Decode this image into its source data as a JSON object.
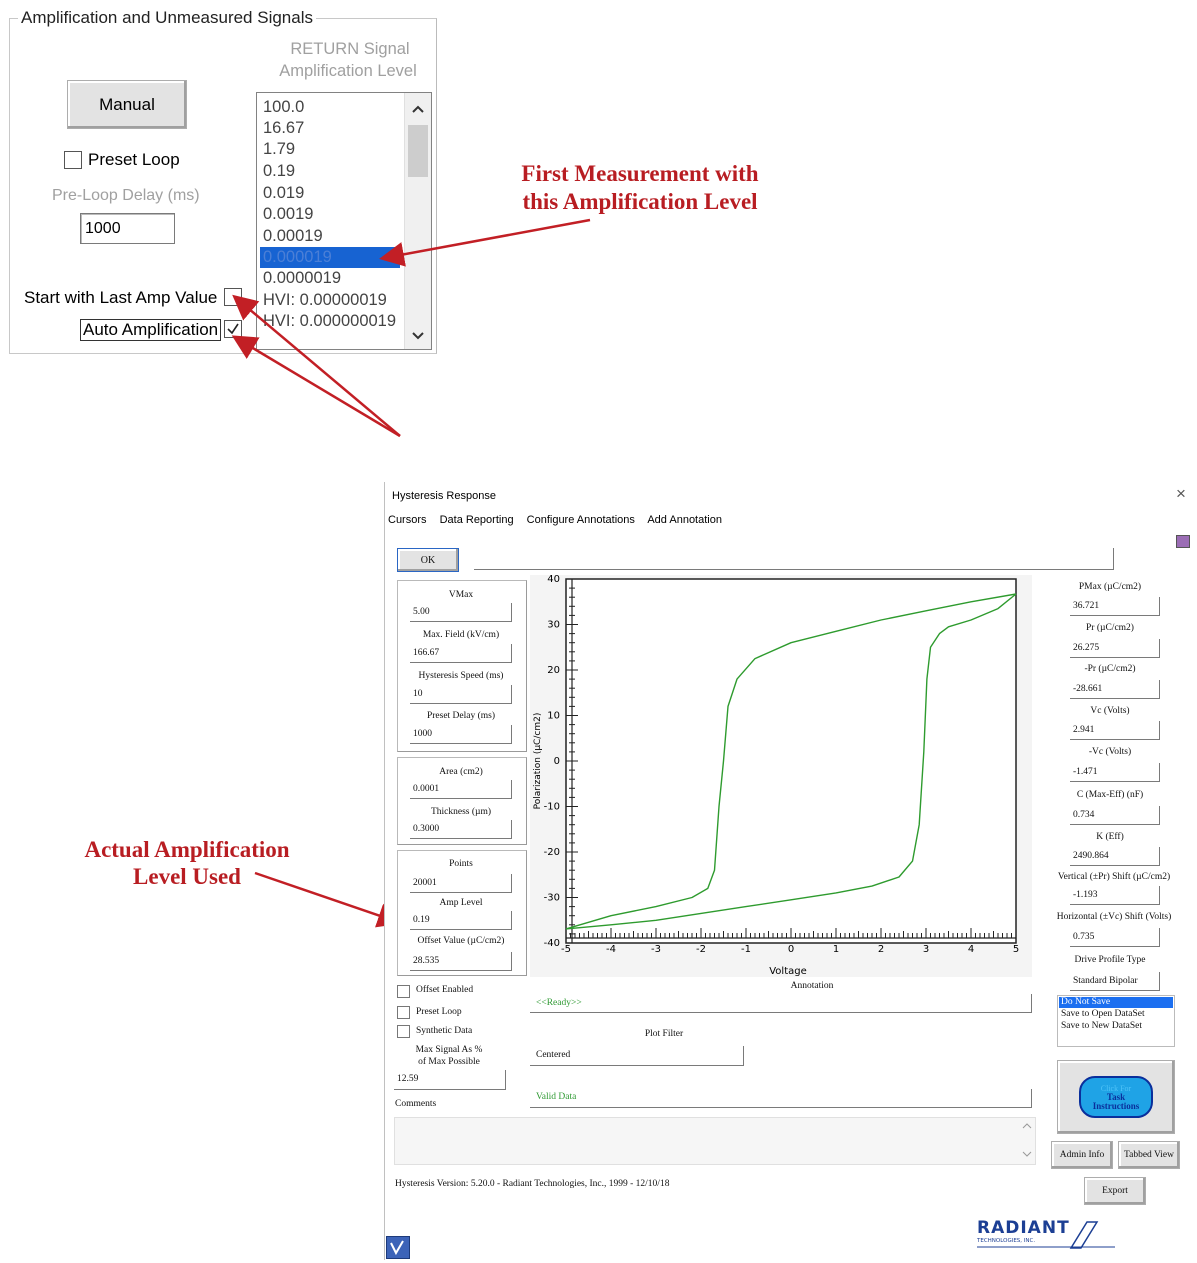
{
  "amp_panel": {
    "title": "Amplification and Unmeasured Signals",
    "manual_button": "Manual",
    "preset_loop_label": "Preset Loop",
    "preset_loop_checked": false,
    "preloop_delay_label": "Pre-Loop Delay (ms)",
    "preloop_delay_value": "1000",
    "return_signal_label_1": "RETURN Signal",
    "return_signal_label_2": "Amplification Level",
    "amp_levels": [
      "100.0",
      "16.67",
      "1.79",
      "0.19",
      "0.019",
      "0.0019",
      "0.00019",
      "0.000019",
      "0.0000019",
      "HVI: 0.00000019",
      "HVI: 0.000000019"
    ],
    "selected_amp_level": "0.000019",
    "start_last_amp_label": "Start with Last Amp Value",
    "start_last_amp_checked": false,
    "auto_amp_label": "Auto Amplification",
    "auto_amp_checked": true
  },
  "annotations": {
    "first_measurement_1": "First Measurement with",
    "first_measurement_2": "this Amplification Level",
    "actual_amp_1": "Actual Amplification",
    "actual_amp_2": "Level Used",
    "color": "#b81d22"
  },
  "hysteresis_window": {
    "title": "Hysteresis Response",
    "close_glyph": "×",
    "menu": [
      "Cursors",
      "Data Reporting",
      "Configure Annotations",
      "Add Annotation"
    ],
    "ok_button": "OK",
    "left": {
      "vmax_label": "VMax",
      "vmax_value": "5.00",
      "max_field_label": "Max. Field (kV/cm)",
      "max_field_value": "166.67",
      "hyst_speed_label": "Hysteresis Speed (ms)",
      "hyst_speed_value": "10",
      "preset_delay_label": "Preset Delay (ms)",
      "preset_delay_value": "1000",
      "area_label": "Area (cm2)",
      "area_value": "0.0001",
      "thickness_label": "Thickness (µm)",
      "thickness_value": "0.3000",
      "points_label": "Points",
      "points_value": "20001",
      "amp_level_label": "Amp Level",
      "amp_level_value": "0.19",
      "offset_label": "Offset Value (µC/cm2)",
      "offset_value": "28.535",
      "offset_enabled_label": "Offset Enabled",
      "preset_loop_label": "Preset Loop",
      "synthetic_data_label": "Synthetic Data",
      "max_signal_label_1": "Max Signal As %",
      "max_signal_label_2": "of Max Possible",
      "max_signal_value": "12.59",
      "comments_label": "Comments"
    },
    "right": {
      "pmax_label": "PMax (µC/cm2)",
      "pmax_value": "36.721",
      "pr_label": "Pr (µC/cm2)",
      "pr_value": "26.275",
      "neg_pr_label": "-Pr (µC/cm2)",
      "neg_pr_value": "-28.661",
      "vc_label": "Vc (Volts)",
      "vc_value": "2.941",
      "neg_vc_label": "-Vc (Volts)",
      "neg_vc_value": "-1.471",
      "c_label": "C (Max-Eff) (nF)",
      "c_value": "0.734",
      "k_label": "K (Eff)",
      "k_value": "2490.864",
      "vshift_label": "Vertical (±Pr) Shift (µC/cm2)",
      "vshift_value": "-1.193",
      "hshift_label": "Horizontal (±Vc) Shift (Volts)",
      "hshift_value": "0.735",
      "drive_profile_label": "Drive Profile Type",
      "drive_profile_value": "Standard Bipolar",
      "save_options": [
        "Do Not Save",
        "Save to Open DataSet",
        "Save to New DataSet"
      ],
      "task_btn_1": "Click For",
      "task_btn_2": "Task",
      "task_btn_3": "Instructions",
      "admin_info": "Admin Info",
      "tabbed_view": "Tabbed View",
      "export": "Export",
      "logo_text": "RADIANT",
      "logo_sub": "TECHNOLOGIES, INC."
    },
    "center": {
      "annotation_label": "Annotation",
      "status": "<<Ready>>",
      "plot_filter_label": "Plot Filter",
      "plot_filter_value": "Centered",
      "valid_data": "Valid Data"
    },
    "footer": "Hysteresis Version: 5.20.0 - Radiant Technologies, Inc., 1999 - 12/10/18"
  },
  "chart_data": {
    "type": "line",
    "xlabel": "Voltage",
    "ylabel": "Polarization (µC/cm2)",
    "xlim": [
      -5,
      5
    ],
    "ylim": [
      -40,
      40
    ],
    "xticks": [
      -5,
      -4,
      -3,
      -2,
      -1,
      0,
      1,
      2,
      3,
      4,
      5
    ],
    "yticks": [
      40,
      30,
      20,
      10,
      0,
      -10,
      -20,
      -30,
      -40
    ],
    "series": [
      {
        "color": "#2e9b2e",
        "x": [
          5.0,
          4.6,
          4.0,
          3.5,
          3.3,
          3.1,
          3.02,
          2.95,
          2.85,
          2.7,
          2.4,
          1.8,
          1.0,
          0.0,
          -1.0,
          -2.0,
          -3.0,
          -4.0,
          -5.0
        ],
        "y": [
          36.7,
          33.5,
          31.0,
          29.5,
          28.0,
          25.0,
          18.0,
          2.0,
          -14.0,
          -22.0,
          -25.5,
          -27.5,
          -29.0,
          -30.5,
          -32.0,
          -33.5,
          -35.0,
          -36.0,
          -36.9
        ]
      },
      {
        "color": "#2e9b2e",
        "x": [
          -5.0,
          -4.0,
          -3.0,
          -2.2,
          -1.85,
          -1.7,
          -1.6,
          -1.5,
          -1.4,
          -1.2,
          -0.8,
          0.0,
          1.0,
          2.0,
          3.0,
          4.0,
          5.0
        ],
        "y": [
          -36.9,
          -34.0,
          -32.0,
          -30.0,
          -28.0,
          -24.0,
          -10.0,
          0.0,
          12.0,
          18.0,
          22.5,
          26.0,
          28.5,
          31.0,
          33.0,
          35.0,
          36.7
        ]
      }
    ]
  }
}
